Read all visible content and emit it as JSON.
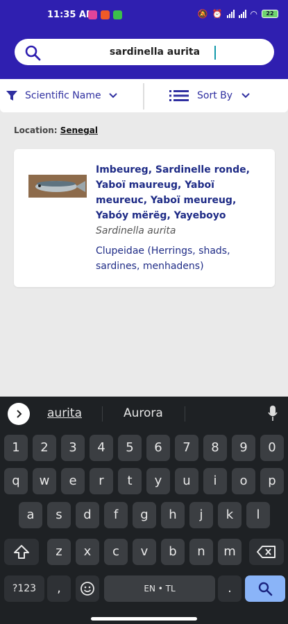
{
  "status_bar": {
    "time": "11:35 AM",
    "battery": "22"
  },
  "search": {
    "value": "sardinella aurita"
  },
  "filter": {
    "scientific_name_label": "Scientific Name",
    "sort_label": "Sort By"
  },
  "location": {
    "label": "Location:",
    "value": "Senegal"
  },
  "result": {
    "common_names": "Imbeureg, Sardinelle ronde, Yaboï maureug, Yaboï meureuc, Yaboï meureug, Yabóy mërëg, Yayeboyo",
    "scientific_name": "Sardinella aurita",
    "family": "Clupeidae (Herrings, shads, sardines, menhadens)"
  },
  "keyboard": {
    "suggestions": [
      "aurita",
      "Aurora"
    ],
    "row_numbers": [
      "1",
      "2",
      "3",
      "4",
      "5",
      "6",
      "7",
      "8",
      "9",
      "0"
    ],
    "row1": [
      "q",
      "w",
      "e",
      "r",
      "t",
      "y",
      "u",
      "i",
      "o",
      "p"
    ],
    "row2": [
      "a",
      "s",
      "d",
      "f",
      "g",
      "h",
      "j",
      "k",
      "l"
    ],
    "row3": [
      "z",
      "x",
      "c",
      "v",
      "b",
      "n",
      "m"
    ],
    "symbols_label": "?123",
    "comma": ",",
    "space_label": "EN • TL",
    "period": "."
  },
  "icons": [
    "search-icon",
    "filter-icon",
    "chevron-down-icon",
    "list-icon",
    "mic-icon",
    "shift-icon",
    "backspace-icon",
    "emoji-icon",
    "chevron-right-icon"
  ],
  "colors": {
    "header": "#2f1fb0",
    "link_text": "#1e2b86",
    "keyboard_bg": "#1e2124",
    "search_key": "#8ab4f8"
  }
}
